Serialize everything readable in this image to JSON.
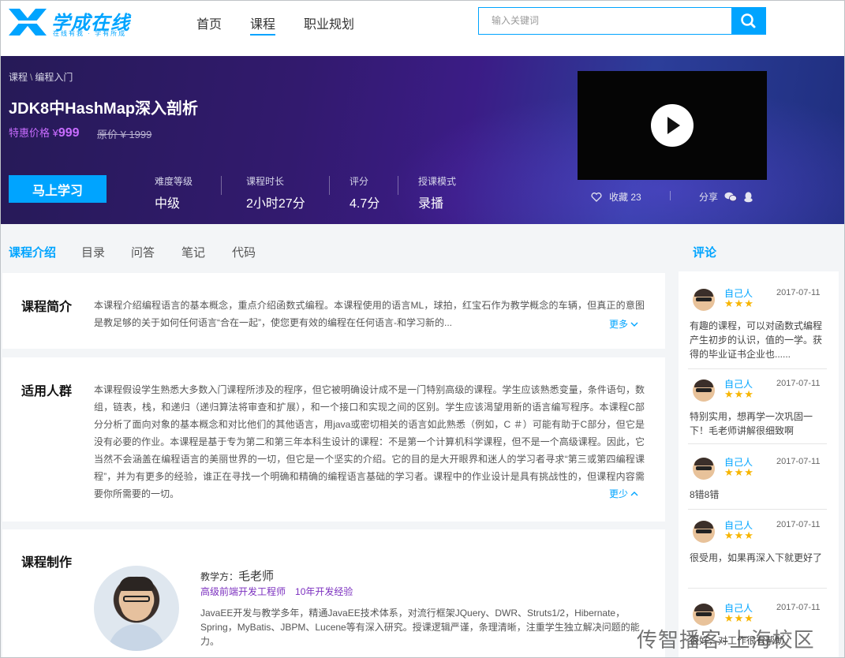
{
  "header": {
    "logo_text": "学成在线",
    "logo_sub": "在线有我 · 学有所成",
    "nav": [
      {
        "label": "首页",
        "active": false
      },
      {
        "label": "课程",
        "active": true
      },
      {
        "label": "职业规划",
        "active": false
      }
    ],
    "search_placeholder": "输入关键词"
  },
  "banner": {
    "breadcrumb": [
      "课程",
      "编程入门"
    ],
    "title": "JDK8中HashMap深入剖析",
    "price_label": "特惠价格 ¥",
    "price_value": "999",
    "orig_price": "原价 ¥ 1999",
    "learn_button": "马上学习",
    "stats": [
      {
        "label": "难度等级",
        "value": "中级"
      },
      {
        "label": "课程时长",
        "value": "2小时27分"
      },
      {
        "label": "评分",
        "value": "4.7分"
      },
      {
        "label": "授课模式",
        "value": "录播"
      }
    ],
    "fav_label": "收藏 23",
    "share_label": "分享"
  },
  "tabs": [
    {
      "label": "课程介绍",
      "active": true
    },
    {
      "label": "目录",
      "active": false
    },
    {
      "label": "问答",
      "active": false
    },
    {
      "label": "笔记",
      "active": false
    },
    {
      "label": "代码",
      "active": false
    }
  ],
  "comments_title": "评论",
  "intro": {
    "title": "课程简介",
    "text": "本课程介绍编程语言的基本概念，重点介绍函数式编程。本课程使用的语言ML，球拍，红宝石作为教学概念的车辆，但真正的意图是教足够的关于如何任何语言“合在一起”，使您更有效的编程在任何语言-和学习新的...",
    "more": "更多"
  },
  "audience": {
    "title": "适用人群",
    "text": "本课程假设学生熟悉大多数入门课程所涉及的程序，但它被明确设计成不是一门特别高级的课程。学生应该熟悉变量，条件语句，数组，链表，栈，和递归（递归算法将审查和扩展），和一个接口和实现之间的区别。学生应该渴望用新的语言编写程序。本课程C部分分析了面向对象的基本概念和对比他们的其他语言，用java或密切相关的语言如此熟悉（例如，C ＃）可能有助于C部分，但它是没有必要的作业。本课程是基于专为第二和第三年本科生设计的课程：不是第一个计算机科学课程，但不是一个高级课程。因此，它当然不会涵盖在编程语言的美丽世界的一切，但它是一个坚实的介绍。它的目的是大开眼界和迷人的学习者寻求“第三或第四编程课程”，并为有更多的经验，谁正在寻找一个明确和精确的编程语言基础的学习者。课程中的作业设计是具有挑战性的，但课程内容需要你所需要的一切。",
    "less": "更少"
  },
  "production": {
    "title": "课程制作",
    "teacher_label": "教学方：",
    "teacher_name": "毛老师",
    "teacher_title": "高级前端开发工程师",
    "teacher_exp": "10年开发经验",
    "teacher_bio": "JavaEE开发与教学多年，精通JavaEE技术体系，对流行框架JQuery、DWR、Struts1/2，Hibernate，Spring，MyBatis、JBPM、Lucene等有深入研究。授课逻辑严谨，条理清晰，注重学生独立解决问题的能力。"
  },
  "comments": [
    {
      "name": "自己人",
      "stars": "★★★",
      "date": "2017-07-11",
      "text": "有趣的课程，可以对函数式编程产生初步的认识，值的一学。获得的毕业证书企业也......"
    },
    {
      "name": "自己人",
      "stars": "★★★",
      "date": "2017-07-11",
      "text": "特别实用，想再学一次巩固一下！毛老师讲解很细致啊"
    },
    {
      "name": "自己人",
      "stars": "★★★",
      "date": "2017-07-11",
      "text": "8错8错"
    },
    {
      "name": "自己人",
      "stars": "★★★",
      "date": "2017-07-11",
      "text": "很受用，如果再深入下就更好了"
    },
    {
      "name": "自己人",
      "stars": "★★★",
      "date": "2017-07-11",
      "text": "很好，对工作很有帮助"
    }
  ],
  "watermark": "传智播客-上海校区",
  "colors": {
    "accent": "#00a4ff",
    "price": "#c86cff",
    "star": "#f7b500"
  }
}
